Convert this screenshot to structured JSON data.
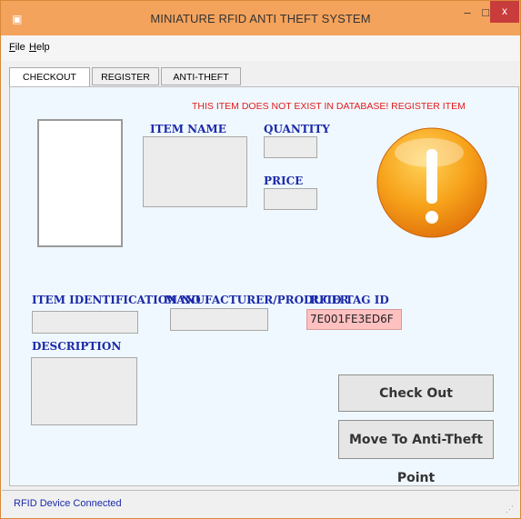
{
  "window": {
    "title": "MINIATURE RFID ANTI THEFT SYSTEM",
    "controls": {
      "minimize": "–",
      "maximize": "□",
      "close": "x"
    }
  },
  "menu": {
    "file": "File",
    "help": "Help"
  },
  "tabs": [
    {
      "label": "CHECKOUT POINT",
      "active": true
    },
    {
      "label": "REGISTER ITEM",
      "active": false
    },
    {
      "label": "ANTI-THEFT POINT",
      "active": false
    }
  ],
  "checkout": {
    "warning": "THIS ITEM DOES NOT EXIST IN DATABASE! REGISTER ITEM",
    "labels": {
      "item_name": "ITEM NAME",
      "quantity": "QUANTITY",
      "price": "PRICE",
      "item_id": "ITEM IDENTIFICATION NO",
      "manufacturer": "MANUFACTURER/PRODUCER",
      "rfid_tag": "RFID TAG ID",
      "description": "DESCRIPTION"
    },
    "values": {
      "item_name": "",
      "quantity": "",
      "price": "",
      "item_id": "",
      "manufacturer": "",
      "rfid_tag": "7E001FE3ED6F",
      "description": ""
    },
    "buttons": {
      "check_out": "Check Out",
      "move_anti_theft": "Move To Anti-Theft Point"
    },
    "alert_icon": "exclamation-icon"
  },
  "status": {
    "text": "RFID Device Connected"
  },
  "colors": {
    "title_bar": "#f4a35c",
    "label_blue": "#1b2aa8",
    "warning_red": "#e21b1b",
    "rfid_field": "#ffc0c0",
    "alert_orange": "#f08a10"
  }
}
